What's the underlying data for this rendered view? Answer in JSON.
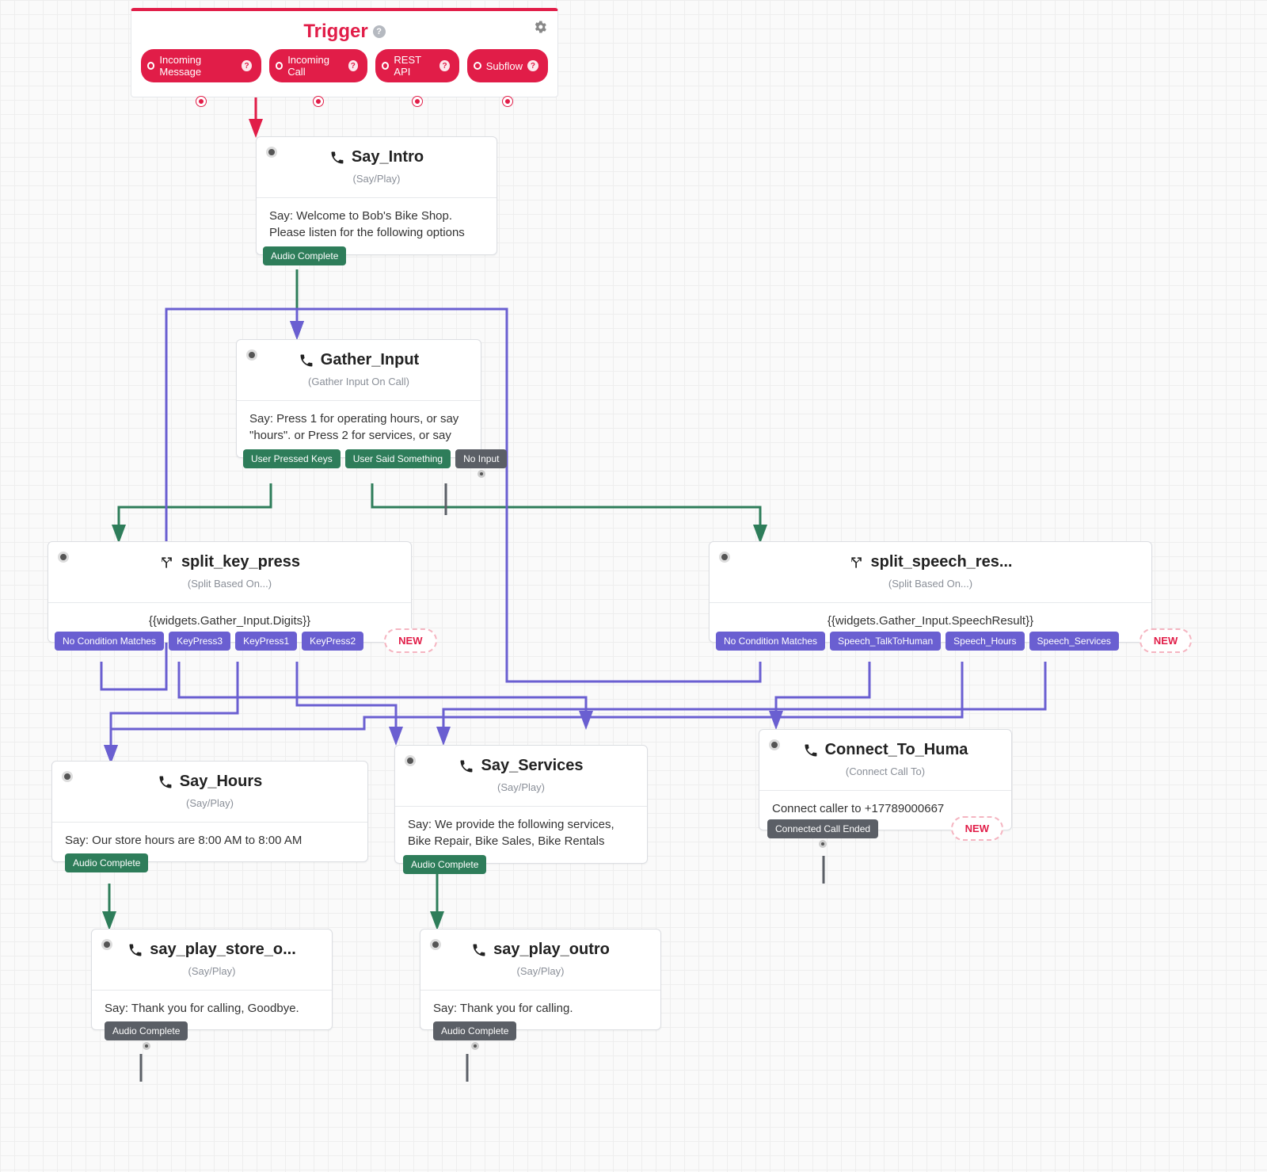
{
  "trigger": {
    "title": "Trigger",
    "outputs": [
      "Incoming Message",
      "Incoming Call",
      "REST API",
      "Subflow"
    ]
  },
  "widgets": {
    "say_intro": {
      "title": "Say_Intro",
      "subtitle": "(Say/Play)",
      "body": "Say: Welcome to Bob's Bike Shop. Please listen for the following options",
      "outputs": [
        {
          "label": "Audio Complete",
          "kind": "green"
        }
      ]
    },
    "gather_input": {
      "title": "Gather_Input",
      "subtitle": "(Gather Input On Call)",
      "body": "Say: Press 1 for operating hours, or say \"hours\". or Press 2 for services, or say",
      "outputs": [
        {
          "label": "User Pressed Keys",
          "kind": "green"
        },
        {
          "label": "User Said Something",
          "kind": "green"
        },
        {
          "label": "No Input",
          "kind": "grey"
        }
      ]
    },
    "split_key_press": {
      "title": "split_key_press",
      "subtitle": "(Split Based On...)",
      "body": "{{widgets.Gather_Input.Digits}}",
      "outputs": [
        {
          "label": "No Condition Matches",
          "kind": "purple"
        },
        {
          "label": "KeyPress3",
          "kind": "purple"
        },
        {
          "label": "KeyPress1",
          "kind": "purple"
        },
        {
          "label": "KeyPress2",
          "kind": "purple"
        }
      ],
      "new_label": "NEW"
    },
    "split_speech_res": {
      "title": "split_speech_res...",
      "subtitle": "(Split Based On...)",
      "body": "{{widgets.Gather_Input.SpeechResult}}",
      "outputs": [
        {
          "label": "No Condition Matches",
          "kind": "purple"
        },
        {
          "label": "Speech_TalkToHuman",
          "kind": "purple"
        },
        {
          "label": "Speech_Hours",
          "kind": "purple"
        },
        {
          "label": "Speech_Services",
          "kind": "purple"
        }
      ],
      "new_label": "NEW"
    },
    "say_hours": {
      "title": "Say_Hours",
      "subtitle": "(Say/Play)",
      "body": "Say: Our store hours are 8:00 AM to 8:00 AM",
      "outputs": [
        {
          "label": "Audio Complete",
          "kind": "green"
        }
      ]
    },
    "say_services": {
      "title": "Say_Services",
      "subtitle": "(Say/Play)",
      "body": "Say: We provide the following services, Bike Repair, Bike Sales, Bike Rentals",
      "outputs": [
        {
          "label": "Audio Complete",
          "kind": "green"
        }
      ]
    },
    "connect_to_human": {
      "title": "Connect_To_Huma",
      "subtitle": "(Connect Call To)",
      "body": "Connect caller to +17789000667",
      "outputs": [
        {
          "label": "Connected Call Ended",
          "kind": "grey"
        }
      ],
      "new_label": "NEW"
    },
    "say_play_store": {
      "title": "say_play_store_o...",
      "subtitle": "(Say/Play)",
      "body": "Say: Thank you for calling, Goodbye.",
      "outputs": [
        {
          "label": "Audio Complete",
          "kind": "grey"
        }
      ]
    },
    "say_play_outro": {
      "title": "say_play_outro",
      "subtitle": "(Say/Play)",
      "body": "Say: Thank you for calling.",
      "outputs": [
        {
          "label": "Audio Complete",
          "kind": "grey"
        }
      ]
    }
  }
}
